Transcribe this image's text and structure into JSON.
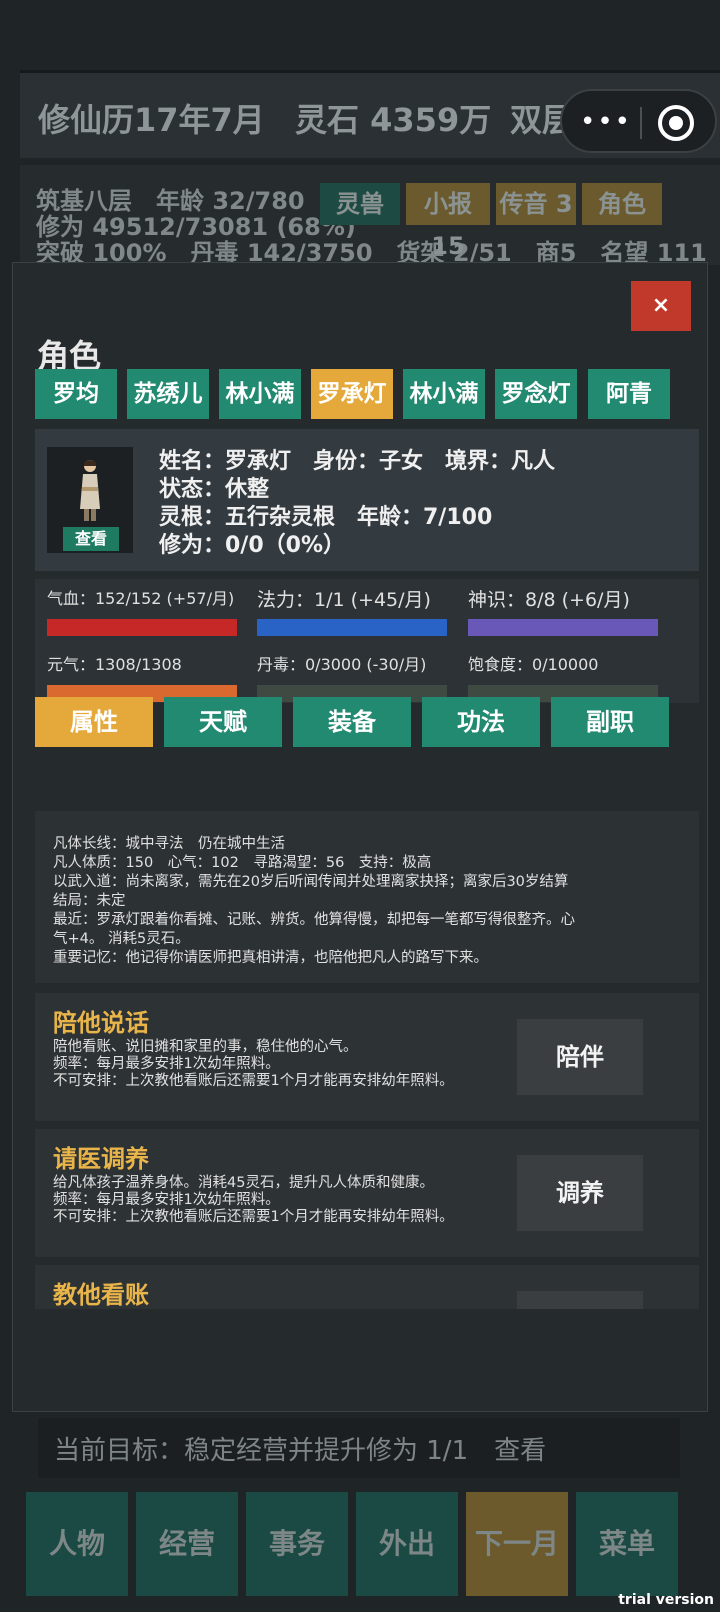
{
  "topbar": {
    "date": "修仙历17年7月",
    "spirit_stones": "灵石 4359万",
    "shop": "双层大铺"
  },
  "infobar": {
    "line1": "筑基八层　年龄 32/780",
    "line2": "修为 49512/73081 (68%)",
    "line3": "突破 100%　丹毒 142/3750　货架 2/51　商5　名望 111",
    "buttons": [
      "灵兽",
      "小报 15",
      "传音 3",
      "角色"
    ]
  },
  "modal": {
    "close_label": "×",
    "title": "角色",
    "character_tabs": [
      "罗均",
      "苏绣儿",
      "林小满",
      "罗承灯",
      "林小满",
      "罗念灯",
      "阿青"
    ],
    "profile": {
      "view_label": "查看",
      "line1": "姓名：罗承灯　身份：子女　境界：凡人",
      "line2": "状态：休整",
      "line3": "灵根：五行杂灵根　年龄：7/100",
      "line4": "修为：0/0（0%）"
    },
    "stats": [
      {
        "label": "气血：152/152 (+57/月)",
        "fill": 1.0,
        "color": "#c62828"
      },
      {
        "label": "法力：1/1 (+45/月)",
        "fill": 1.0,
        "color": "#2a63c6"
      },
      {
        "label": "神识：8/8 (+6/月)",
        "fill": 1.0,
        "color": "#6a58b8"
      },
      {
        "label": "元气：1308/1308",
        "fill": 1.0,
        "color": "#d9692e"
      },
      {
        "label": "丹毒：0/3000 (-30/月)",
        "fill": 0.0,
        "color": "#3f4a42"
      },
      {
        "label": "饱食度：0/10000",
        "fill": 0.0,
        "color": "#3f4a42"
      }
    ],
    "section_tabs": [
      "属性",
      "天赋",
      "装备",
      "功法",
      "副职"
    ],
    "description": [
      "凡体长线：城中寻法　仍在城中生活",
      "凡人体质：150　心气：102　寻路渴望：56　支持：极高",
      "以武入道：尚未离家，需先在20岁后听闻传闻并处理离家抉择；离家后30岁结算",
      "结局：未定",
      "最近：罗承灯跟着你看摊、记账、辨货。他算得慢，却把每一笔都写得很整齐。心",
      "气+4。 消耗5灵石。",
      "重要记忆：他记得你请医师把真相讲清，也陪他把凡人的路写下来。"
    ],
    "cards": [
      {
        "title": "陪他说话",
        "lines": [
          "陪他看账、说旧摊和家里的事，稳住他的心气。",
          "频率：每月最多安排1次幼年照料。",
          "不可安排：上次教他看账后还需要1个月才能再安排幼年照料。"
        ],
        "action": "陪伴"
      },
      {
        "title": "请医调养",
        "lines": [
          "给凡体孩子温养身体。消耗45灵石，提升凡人体质和健康。",
          "频率：每月最多安排1次幼年照料。",
          "不可安排：上次教他看账后还需要1个月才能再安排幼年照料。"
        ],
        "action": "调养"
      },
      {
        "title": "教他看账",
        "lines": [],
        "action": ""
      }
    ]
  },
  "goal": {
    "text": "当前目标：稳定经营并提升修为 1/1　查看"
  },
  "bottom_nav": [
    "人物",
    "经营",
    "事务",
    "外出",
    "下一月",
    "菜单"
  ],
  "watermark": "trial version"
}
